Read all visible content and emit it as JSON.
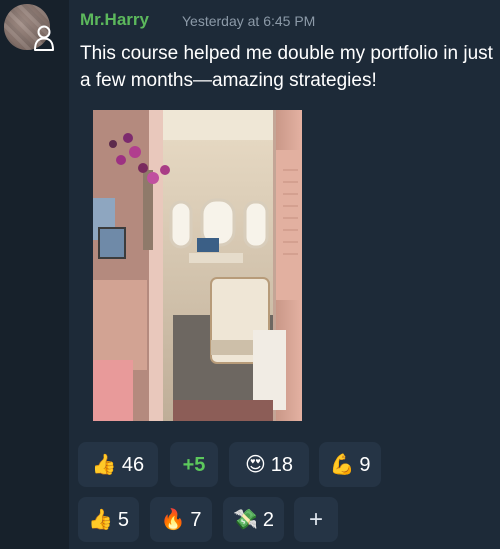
{
  "message": {
    "sender": "Mr.Harry",
    "timestamp": "Yesterday at 6:45 PM",
    "text": "This course helped me double my portfolio in just a few months—amazing strategies!"
  },
  "avatar_badge_icon": "user-outline-icon",
  "reactions": [
    {
      "emoji": "👍",
      "count": "46",
      "icon": "thumbs-up-icon"
    },
    {
      "label": "+5"
    },
    {
      "emoji": "😍",
      "count": "18",
      "icon": "heart-eyes-icon"
    },
    {
      "emoji": "💪",
      "count": "9",
      "icon": "flexed-biceps-icon"
    },
    {
      "emoji": "👍",
      "count": "5",
      "icon": "thumbs-up-icon"
    },
    {
      "emoji": "🔥",
      "count": "7",
      "icon": "fire-icon"
    },
    {
      "emoji": "💸",
      "count": "2",
      "icon": "money-with-wings-icon"
    },
    {
      "label": "+",
      "icon": "add-reaction-icon"
    }
  ],
  "colors": {
    "background": "#1d2a38",
    "rail": "#17212b",
    "sender": "#5cb85c",
    "chip": "#253445",
    "plus_accent": "#5cc85c"
  }
}
